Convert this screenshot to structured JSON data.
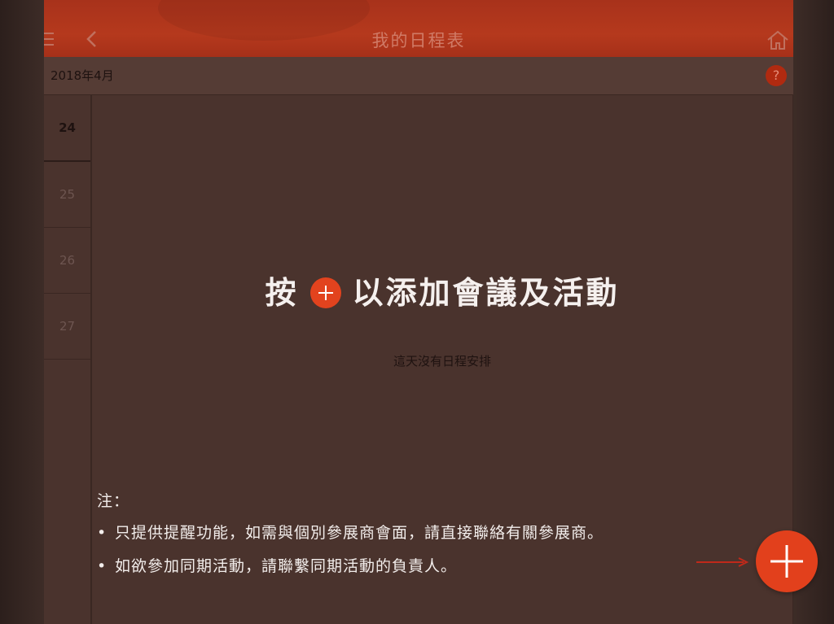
{
  "header": {
    "title": "我的日程表",
    "menu_icon": "menu-icon",
    "back_icon": "chevron-left-icon",
    "home_icon": "home-icon"
  },
  "month_bar": {
    "label": "2018年4月",
    "help_label": "?"
  },
  "dates": [
    "24",
    "25",
    "26",
    "27"
  ],
  "selected_date": "24",
  "main": {
    "hint_prefix": "按",
    "hint_suffix": "以添加會議及活動",
    "empty_message": "這天沒有日程安排",
    "note_title": "注：",
    "notes": [
      "只提供提醒功能，如需與個別參展商會面，請直接聯絡有關參展商。",
      "如欲參加同期活動，請聯繫同期活動的負責人。"
    ]
  },
  "colors": {
    "header": "#b5391d",
    "accent": "#e2401c",
    "background": "#4a332d",
    "arrow": "#c0291a"
  }
}
